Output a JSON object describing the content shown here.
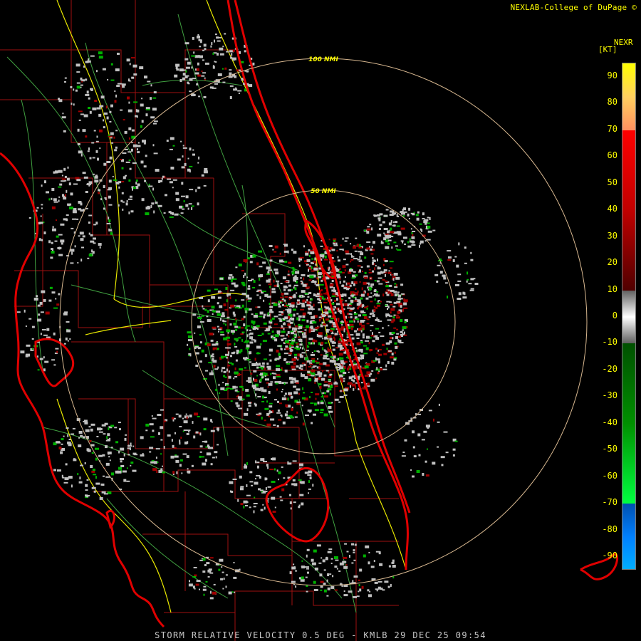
{
  "header": {
    "credit": "NEXLAB-College of DuPage ©"
  },
  "legend": {
    "product": "NEXR",
    "unit": "[KT]",
    "ticks": [
      "90",
      "80",
      "70",
      "60",
      "50",
      "40",
      "30",
      "20",
      "10",
      "0",
      "-10",
      "-20",
      "-30",
      "-40",
      "-50",
      "-60",
      "-70",
      "-80",
      "-90"
    ],
    "bands": [
      {
        "from": 95,
        "to": 70,
        "colors": [
          "#ffff00",
          "#ffd060",
          "#ff9060"
        ]
      },
      {
        "from": 70,
        "to": 10,
        "colors": [
          "#ff0000",
          "#c00000",
          "#500000"
        ]
      },
      {
        "from": 10,
        "to": -10,
        "colors": [
          "#606060",
          "#ffffff",
          "#606060"
        ]
      },
      {
        "from": -10,
        "to": -70,
        "colors": [
          "#005000",
          "#009000",
          "#00ff40"
        ]
      },
      {
        "from": -70,
        "to": -95,
        "colors": [
          "#0050b0",
          "#0080ff",
          "#00b0ff"
        ]
      }
    ]
  },
  "rings": [
    {
      "label": "50 NMI"
    },
    {
      "label": "100 NMI"
    }
  ],
  "footer": {
    "product_line": "STORM RELATIVE VELOCITY 0.5 DEG - KMLB 29 DEC 25 09:54"
  },
  "colors": {
    "coastline": "#e00000",
    "counties": "#a01010",
    "roads_major": "#e8e800",
    "roads_minor": "#40a040",
    "rings": "#d8b890",
    "inbound": "#00b000",
    "outbound": "#a00000",
    "nearzero": "#c0c0c0"
  }
}
